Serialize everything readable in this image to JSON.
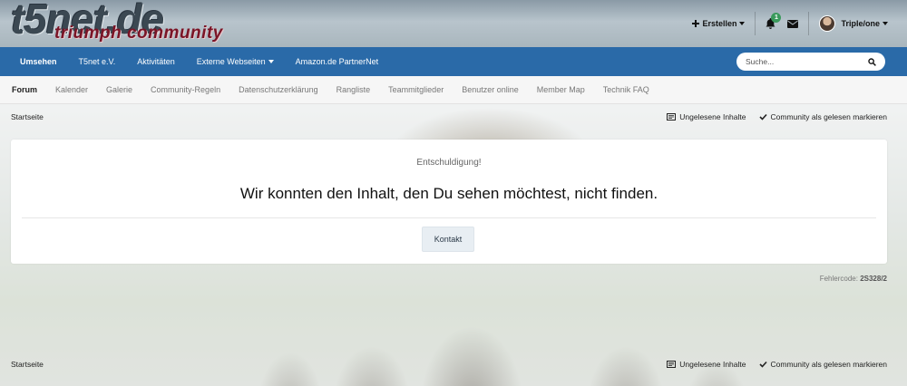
{
  "header": {
    "logo_main": "t5net.de",
    "logo_sub": "triumph community",
    "create_label": "Erstellen",
    "notifications_count": "1",
    "username": "Triple/one"
  },
  "nav": {
    "items": [
      {
        "label": "Umsehen"
      },
      {
        "label": "T5net e.V."
      },
      {
        "label": "Aktivitäten"
      },
      {
        "label": "Externe Webseiten"
      },
      {
        "label": "Amazon.de PartnerNet"
      }
    ],
    "search_placeholder": "Suche..."
  },
  "subnav": {
    "items": [
      {
        "label": "Forum"
      },
      {
        "label": "Kalender"
      },
      {
        "label": "Galerie"
      },
      {
        "label": "Community-Regeln"
      },
      {
        "label": "Datenschutzerklärung"
      },
      {
        "label": "Rangliste"
      },
      {
        "label": "Teammitglieder"
      },
      {
        "label": "Benutzer online"
      },
      {
        "label": "Member Map"
      },
      {
        "label": "Technik FAQ"
      }
    ]
  },
  "breadcrumb": {
    "home": "Startseite",
    "unread": "Ungelesene Inhalte",
    "mark_read": "Community als gelesen markieren"
  },
  "error": {
    "small": "Entschuldigung!",
    "title": "Wir konnten den Inhalt, den Du sehen möchtest, nicht finden.",
    "contact_button": "Kontakt",
    "code_label": "Fehlercode:",
    "code_value": "2S328/2"
  },
  "colors": {
    "nav_bg": "#2a6aa8",
    "logo_sub": "#7a1426",
    "badge": "#3a9a5c"
  }
}
